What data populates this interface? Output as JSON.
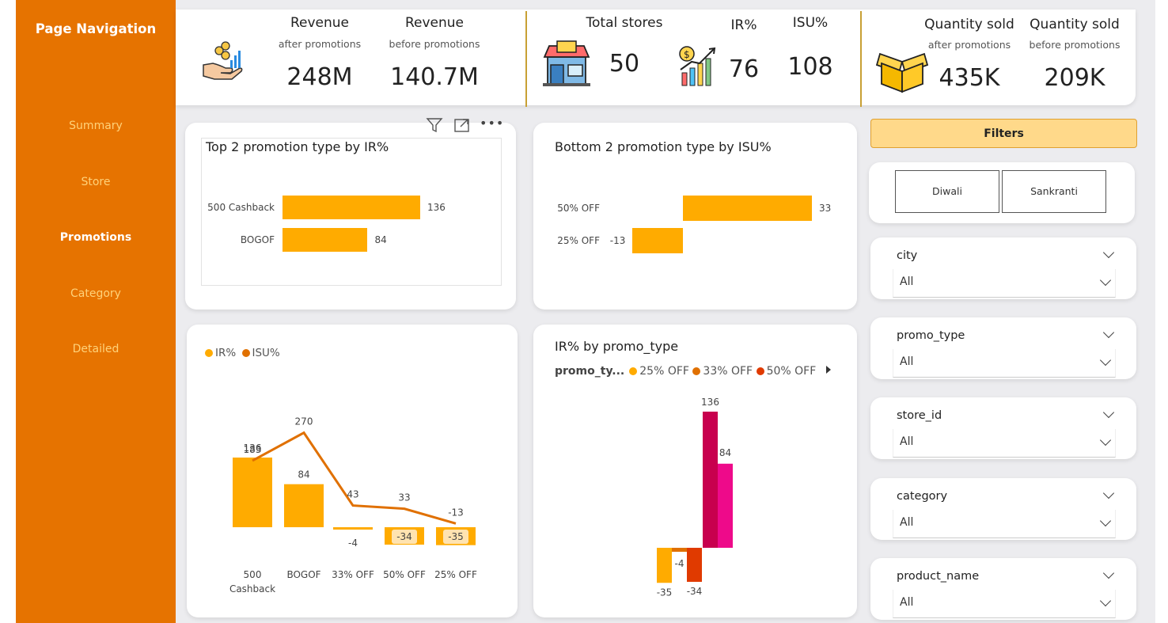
{
  "navigation": {
    "title": "Page Navigation",
    "items": [
      "Summary",
      "Store",
      "Promotions",
      "Category",
      "Detailed"
    ],
    "active": "Promotions"
  },
  "kpis": {
    "revenue_after": {
      "label": "Revenue",
      "sub": "after promotions",
      "value": "248M"
    },
    "revenue_before": {
      "label": "Revenue",
      "sub": "before promotions",
      "value": "140.7M"
    },
    "total_stores": {
      "label": "Total stores",
      "value": "50"
    },
    "ir": {
      "label": "IR%",
      "value": "76"
    },
    "isu": {
      "label": "ISU%",
      "value": "108"
    },
    "qty_after": {
      "label": "Quantity sold",
      "sub": "after promotions",
      "value": "435K"
    },
    "qty_before": {
      "label": "Quantity sold",
      "sub": "before promotions",
      "value": "209K"
    }
  },
  "icons": {
    "revenue": "money-hand-icon",
    "store": "store-icon",
    "growth": "growth-chart-icon",
    "box": "box-icon"
  },
  "colors": {
    "sidebar": "#e67300",
    "bar": "#ffab00",
    "line": "#e07000",
    "accent_gold": "#c8a034",
    "magenta_dark": "#c8004e",
    "magenta": "#ee0a8a",
    "red": "#e03a00"
  },
  "visual_header": {
    "filter_icon": "filter-icon",
    "focus_icon": "focus-mode-icon",
    "more_icon": "more-options-icon"
  },
  "chart_data": [
    {
      "type": "bar",
      "title": "Top 2 promotion type by IR%",
      "categories": [
        "500 Cashback",
        "BOGOF"
      ],
      "values": [
        136,
        84
      ],
      "orientation": "horizontal"
    },
    {
      "type": "bar",
      "title": "Bottom 2 promotion type by ISU%",
      "categories": [
        "50% OFF",
        "25% OFF"
      ],
      "values": [
        33,
        -13
      ],
      "orientation": "horizontal"
    },
    {
      "type": "bar",
      "title": "",
      "categories": [
        "500 Cashback",
        "BOGOF",
        "33% OFF",
        "50% OFF",
        "25% OFF"
      ],
      "series": [
        {
          "name": "IR%",
          "values": [
            136,
            84,
            -4,
            -34,
            -35
          ],
          "style": "bar"
        },
        {
          "name": "ISU%",
          "values": [
            183,
            270,
            43,
            33,
            -13
          ],
          "style": "line"
        }
      ],
      "legend": "top-left"
    },
    {
      "type": "bar",
      "title": "IR% by promo_type",
      "legend_title": "promo_ty...",
      "legend_items": [
        "25% OFF",
        "33% OFF",
        "50% OFF"
      ],
      "values": [
        -35,
        -4,
        -34,
        136,
        84
      ],
      "legend": "top-left"
    }
  ],
  "filters": {
    "button_label": "Filters",
    "festivals": [
      "Diwali",
      "Sankranti"
    ],
    "slicers": [
      {
        "title": "city",
        "value": "All"
      },
      {
        "title": "promo_type",
        "value": "All"
      },
      {
        "title": "store_id",
        "value": "All"
      },
      {
        "title": "category",
        "value": "All"
      },
      {
        "title": "product_name",
        "value": "All"
      }
    ]
  }
}
